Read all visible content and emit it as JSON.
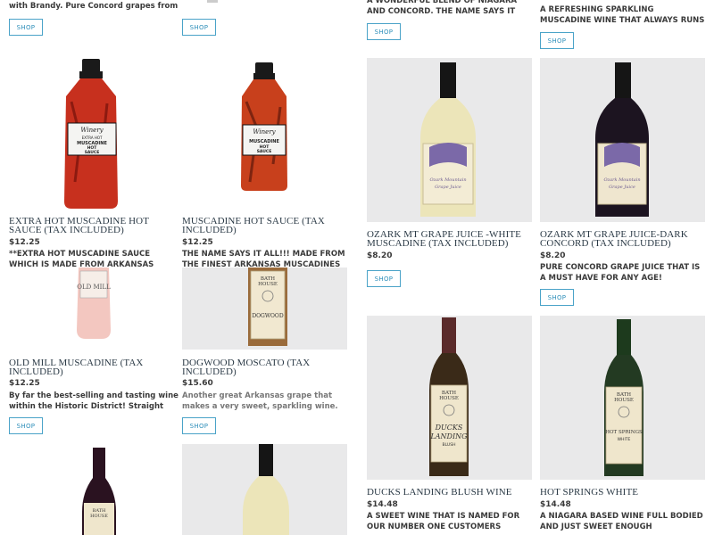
{
  "products": [
    {
      "desc": "with Brandy.  Pure Concord grapes from",
      "shop": "SHOP"
    },
    {
      "shop": "SHOP"
    },
    {
      "desc": "A WONDERFUL BLEND OF NIAGARA AND CONCORD.  THE NAME SAYS IT ALL!!",
      "shop": "SHOP"
    },
    {
      "desc": "A REFRESHING SPARKLING MUSCADINE WINE THAT ALWAYS RUNS IN SHORT",
      "shop": "SHOP"
    },
    {
      "title": "EXTRA HOT MUSCADINE HOT SAUCE (TAX INCLUDED)",
      "price": "$12.25",
      "desc": "**EXTRA HOT MUSCADINE SAUCE WHICH IS MADE FROM ARKANSAS MUSCADINES.",
      "label_brand": "Winery",
      "label_lines": [
        "EXTRA HOT",
        "MUSCADINE",
        "HOT",
        "SAUCE"
      ]
    },
    {
      "title": "MUSCADINE HOT SAUCE (TAX INCLUDED)",
      "price": "$12.25",
      "desc": "THE NAME SAYS IT ALL!!!  MADE FROM THE FINEST ARKANSAS MUSCADINES",
      "label_brand": "Winery",
      "label_lines": [
        "MUSCADINE",
        "HOT",
        "SAUCE"
      ]
    },
    {
      "title": "OZARK MT GRAPE JUICE -WHITE MUSCADINE (TAX INCLUDED)",
      "price": "$8.20",
      "shop": "SHOP",
      "label_lines": [
        "Ozark Mountain",
        "Grape Juice"
      ]
    },
    {
      "title": "OZARK MT GRAPE JUICE-DARK CONCORD (TAX INCLUDED)",
      "price": "$8.20",
      "desc": "PURE CONCORD GRAPE JUICE THAT IS A MUST HAVE FOR ANY AGE!",
      "shop": "SHOP",
      "label_lines": [
        "Ozark Mountain",
        "Grape Juice"
      ]
    },
    {
      "title": "OLD MILL MUSCADINE (TAX INCLUDED)",
      "price": "$12.25",
      "desc": "By far the best-selling and tasting wine within the Historic District!  Straight from",
      "shop": "SHOP",
      "label_lines": [
        "OLD MILL"
      ]
    },
    {
      "title": "DOGWOOD MOSCATO (TAX INCLUDED)",
      "price": "$15.60",
      "desc": "Another great Arkansas grape that makes a very sweet, sparkling wine.",
      "shop": "SHOP",
      "label_lines": [
        "BATH",
        "HOUSE",
        "DOGWOOD"
      ]
    },
    {
      "title": "DUCKS LANDING BLUSH WINE",
      "price": "$14.48",
      "desc": "A SWEET WINE THAT IS NAMED FOR OUR NUMBER ONE CUSTOMERS  **DUCK",
      "label_lines": [
        "BATH",
        "HOUSE",
        "DUCKS",
        "LANDING",
        "BLUSH"
      ]
    },
    {
      "title": "HOT SPRINGS WHITE",
      "price": "$14.48",
      "desc": "A NIAGARA BASED WINE FULL BODIED AND JUST SWEET ENOUGH",
      "label_lines": [
        "BATH",
        "HOUSE",
        "HOT SPRINGS",
        "WHITE"
      ]
    },
    {
      "label_lines": [
        "BATH",
        "HOUSE"
      ]
    },
    {}
  ],
  "colors": {
    "accent": "#4aa3c8",
    "title": "#2b3a46",
    "text": "#3a3a3a"
  }
}
